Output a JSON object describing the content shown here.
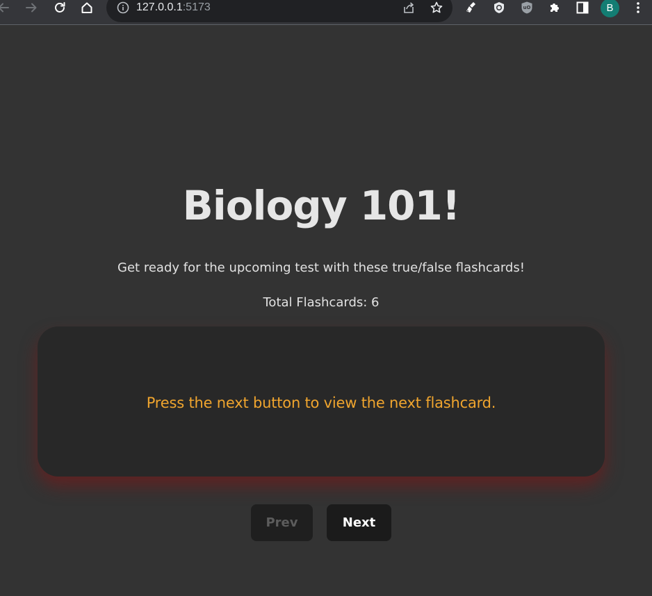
{
  "browser": {
    "url_host": "127.0.0.1",
    "url_port": ":5173",
    "avatar_letter": "B",
    "icons": {
      "back": "arrow-left-icon",
      "forward": "arrow-right-icon",
      "reload": "reload-icon",
      "home": "home-icon",
      "info": "info-icon",
      "share": "share-icon",
      "bookmark": "star-icon",
      "extension_1": "broom-extension-icon",
      "extension_2": "shield-extension-icon",
      "extension_3": "ublock-extension-icon",
      "extensions": "puzzle-icon",
      "side_panel": "side-panel-icon",
      "menu": "kebab-menu-icon"
    },
    "colors": {
      "toolbar": "#35363a",
      "omnibox": "#202124",
      "avatar": "#137d73"
    }
  },
  "page": {
    "title": "Biology 101!",
    "subtitle": "Get ready for the upcoming test with these true/false flashcards!",
    "total_flashcards": "Total Flashcards: 6",
    "card": {
      "text": "Press the next button to view the next flashcard."
    },
    "buttons": {
      "prev": "Prev",
      "next": "Next"
    },
    "colors": {
      "background": "#333333",
      "card": "#282828",
      "card_text": "#f0a52e",
      "card_glow": "#6e1e1e"
    }
  }
}
